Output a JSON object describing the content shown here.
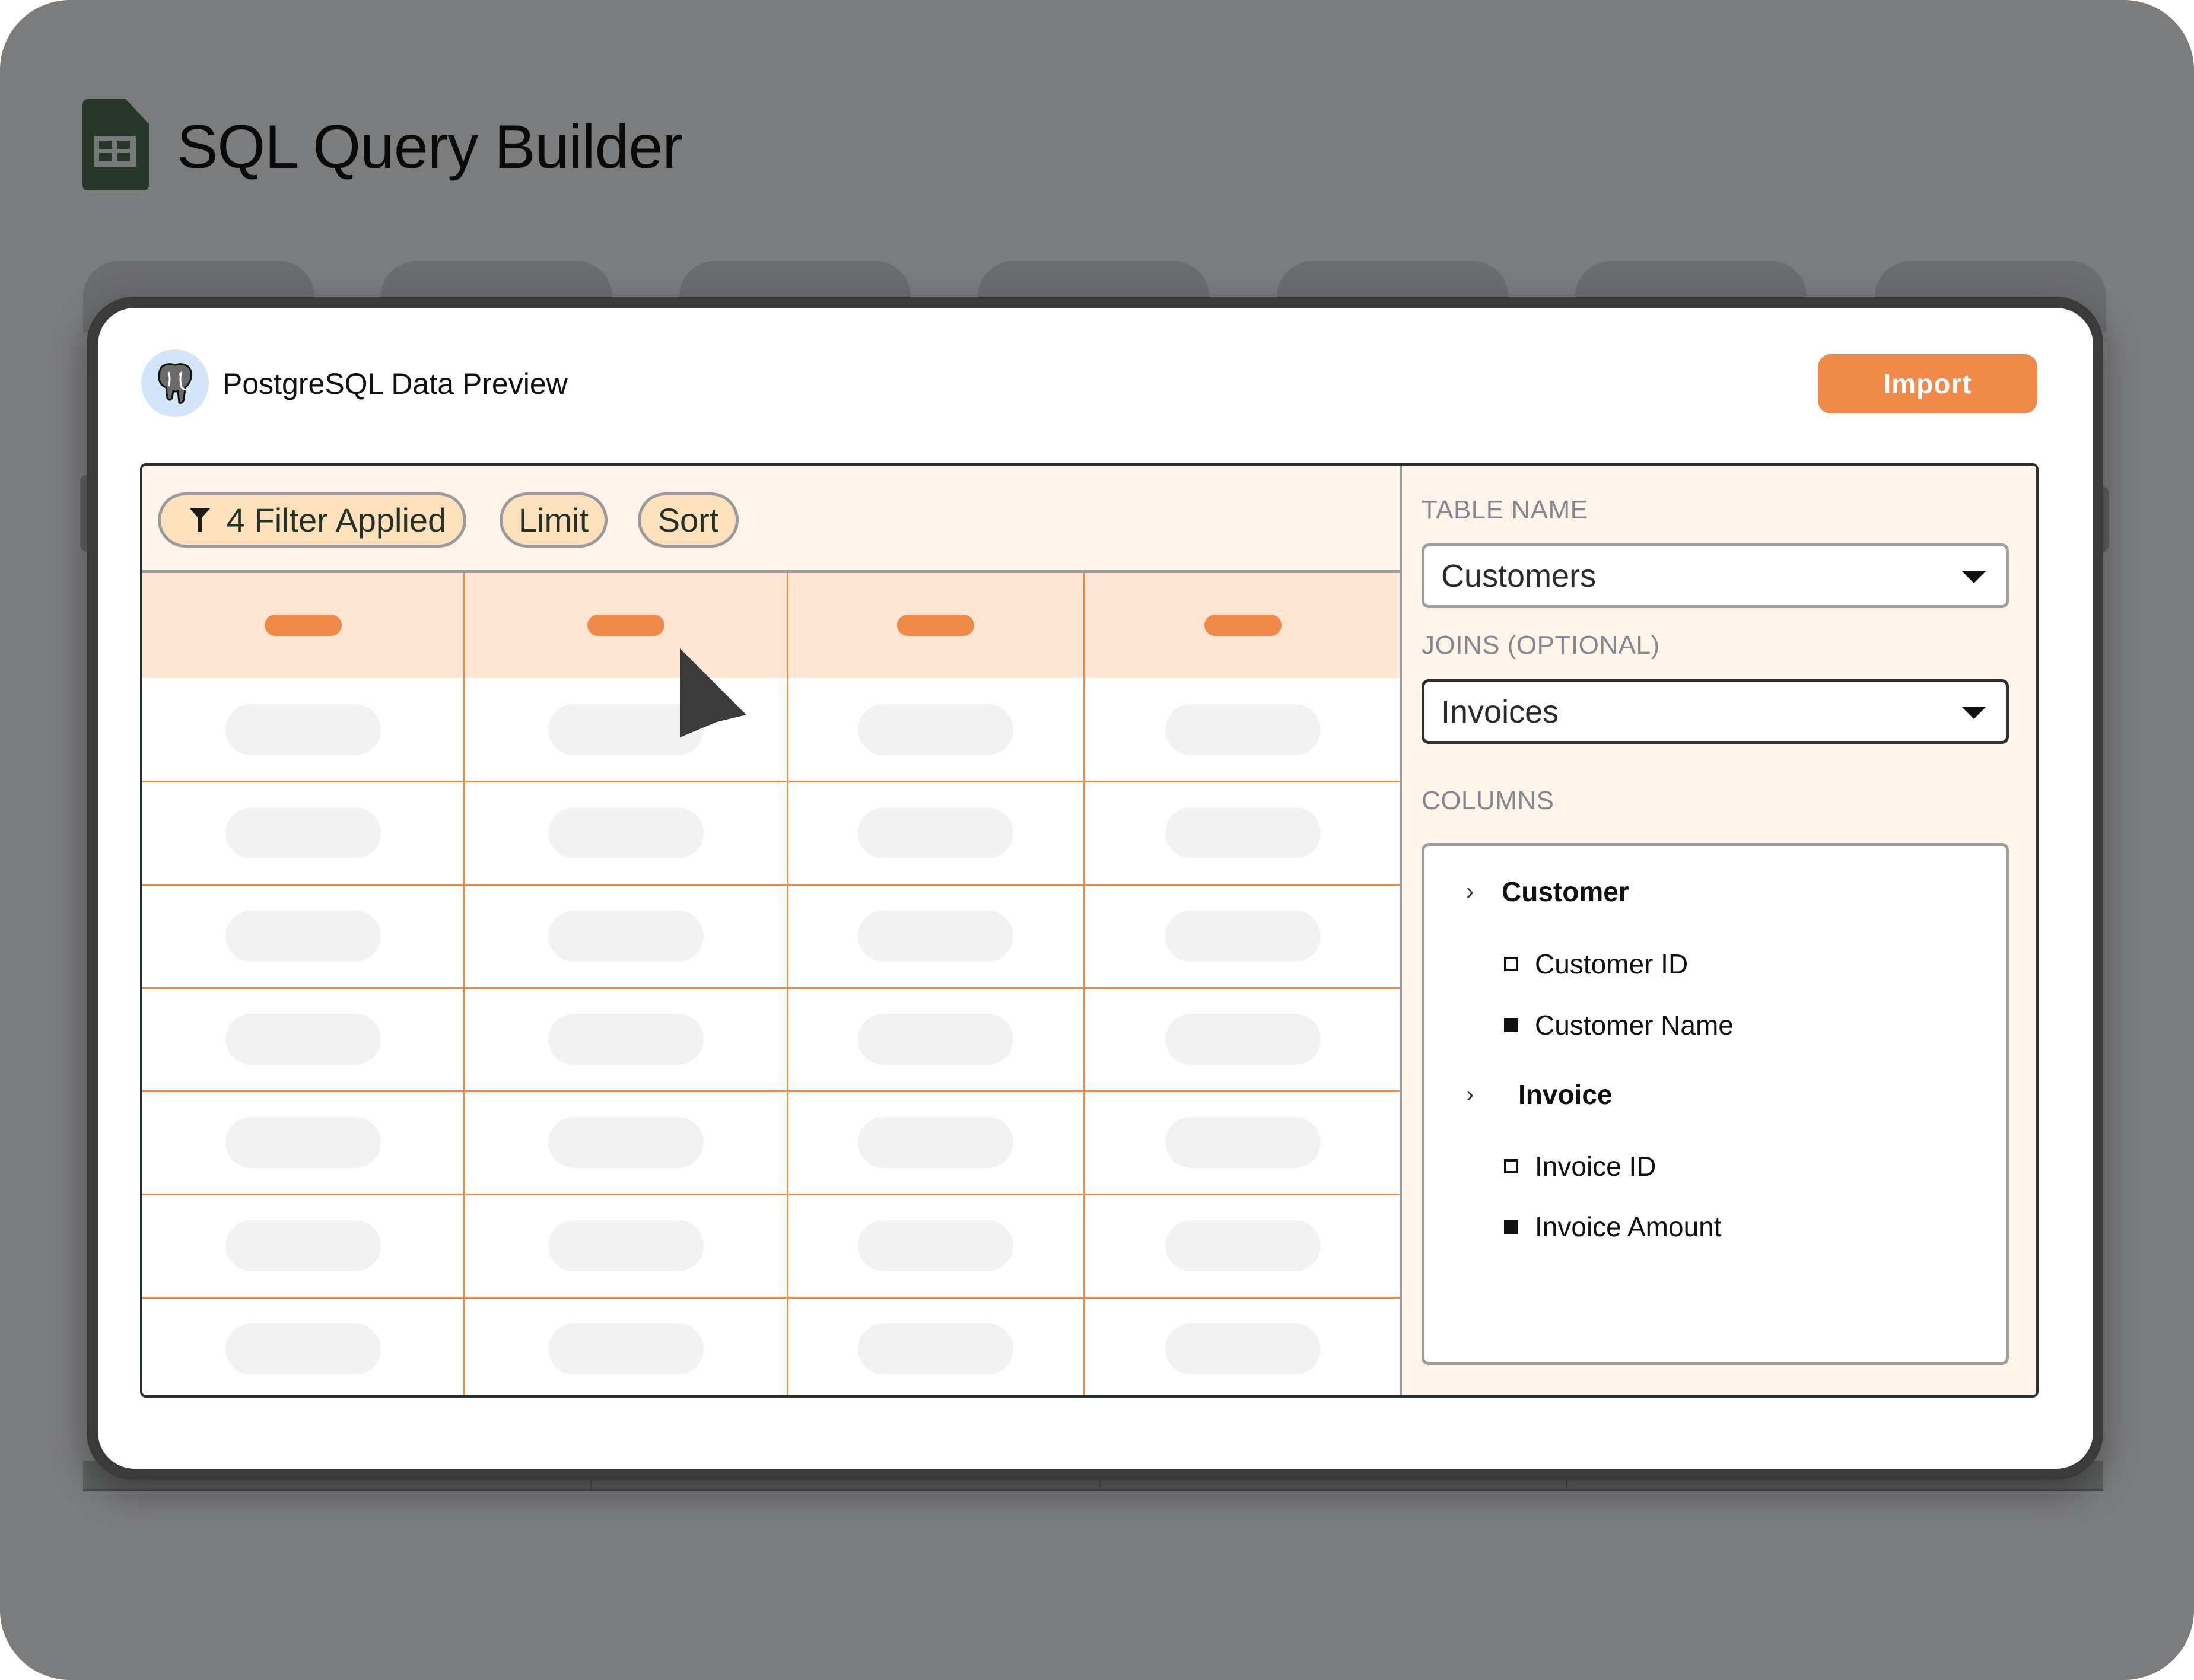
{
  "app": {
    "title": "SQL Query Builder",
    "icon": "spreadsheet-icon"
  },
  "modal": {
    "title": "PostgreSQL Data Preview",
    "logo_icon": "postgresql-elephant-icon",
    "import_label": "Import"
  },
  "toolbar": {
    "filter_label": "4 Filter Applied",
    "filter_icon": "funnel-icon",
    "limit_label": "Limit",
    "sort_label": "Sort"
  },
  "grid": {
    "columns": 4,
    "rows": 7,
    "state": "loading-placeholder"
  },
  "sidebar": {
    "table_name_label": "TABLE NAME",
    "table_name_value": "Customers",
    "joins_label": "JOINS (OPTIONAL)",
    "joins_value": "Invoices",
    "columns_label": "COLUMNS",
    "groups": [
      {
        "name": "Customer",
        "items": [
          {
            "label": "Customer ID",
            "checked": false
          },
          {
            "label": "Customer Name",
            "checked": true
          }
        ]
      },
      {
        "name": "Invoice",
        "items": [
          {
            "label": "Invoice ID",
            "checked": false
          },
          {
            "label": "Invoice Amount",
            "checked": true
          }
        ]
      }
    ]
  },
  "colors": {
    "accent": "#ef8a4a",
    "header_row": "#fee5d4",
    "panel_bg": "#fef4ea",
    "chip_bg": "#fde0bc",
    "logo_bg": "#d2e5fb",
    "app_icon": "#27372a",
    "backdrop": "#7b7c7e"
  }
}
